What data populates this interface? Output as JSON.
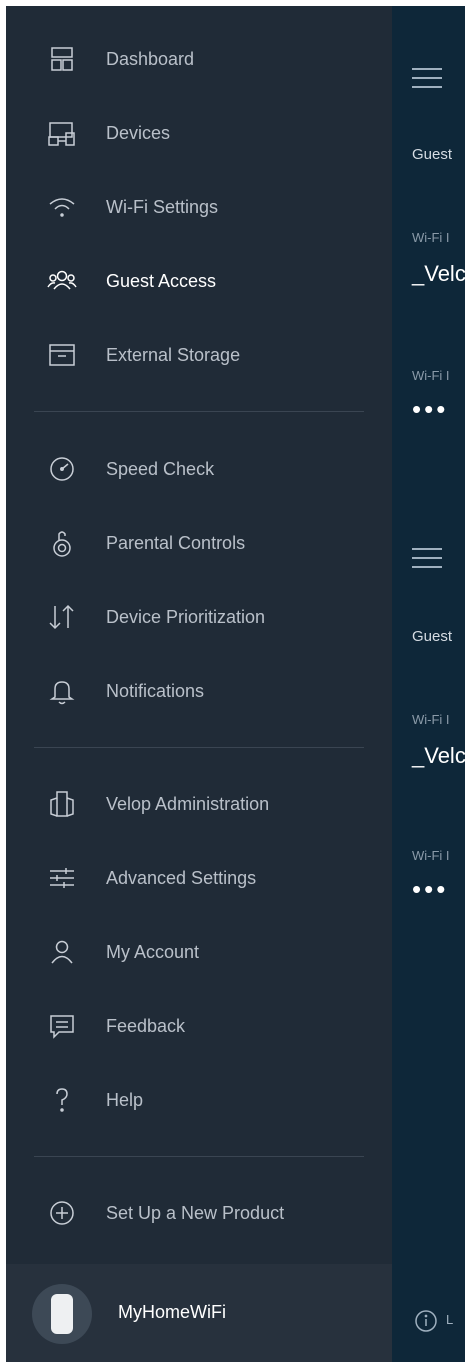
{
  "nav": {
    "group1": [
      {
        "label": "Dashboard",
        "icon": "dashboard-icon"
      },
      {
        "label": "Devices",
        "icon": "devices-icon"
      },
      {
        "label": "Wi-Fi Settings",
        "icon": "wifi-icon"
      },
      {
        "label": "Guest Access",
        "icon": "guest-access-icon",
        "active": true
      },
      {
        "label": "External Storage",
        "icon": "storage-icon"
      }
    ],
    "group2": [
      {
        "label": "Speed Check",
        "icon": "speedometer-icon"
      },
      {
        "label": "Parental Controls",
        "icon": "parental-controls-icon"
      },
      {
        "label": "Device Prioritization",
        "icon": "prioritization-arrows-icon"
      },
      {
        "label": "Notifications",
        "icon": "bell-icon"
      }
    ],
    "group3": [
      {
        "label": "Velop Administration",
        "icon": "velop-admin-icon"
      },
      {
        "label": "Advanced Settings",
        "icon": "sliders-icon"
      },
      {
        "label": "My Account",
        "icon": "person-icon"
      },
      {
        "label": "Feedback",
        "icon": "chat-icon"
      },
      {
        "label": "Help",
        "icon": "question-icon"
      }
    ],
    "group4": [
      {
        "label": "Set Up a New Product",
        "icon": "plus-circle-icon"
      }
    ]
  },
  "footer": {
    "network_name": "MyHomeWiFi"
  },
  "right_panel": {
    "section1": {
      "guest_label": "Guest",
      "wifi_name_label": "Wi-Fi I",
      "wifi_name_value": "_Velc",
      "wifi_pw_label": "Wi-Fi I",
      "wifi_pw_value": "•••"
    },
    "section2": {
      "guest_label": "Guest",
      "wifi_name_label": "Wi-Fi I",
      "wifi_name_value": "_Velc",
      "wifi_pw_label": "Wi-Fi I",
      "wifi_pw_value": "•••"
    },
    "bottom_text": "L"
  },
  "colors": {
    "sidebar_bg": "#202b37",
    "panel_bg": "#0e2739",
    "active_text": "#ffffff",
    "inactive_text": "#b9c0c9"
  }
}
